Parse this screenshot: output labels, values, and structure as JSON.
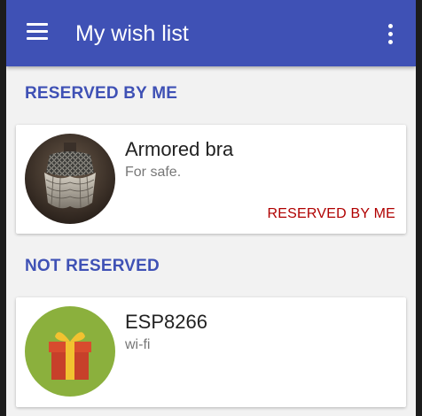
{
  "appbar": {
    "title": "My wish list",
    "menu_icon": "hamburger-menu-icon",
    "overflow_icon": "more-vert-icon",
    "color": "#3f51b5"
  },
  "sections": [
    {
      "header": "RESERVED BY ME",
      "items": [
        {
          "name": "Armored bra",
          "description": "For safe.",
          "status": "RESERVED BY ME",
          "image": "armor-photo"
        }
      ]
    },
    {
      "header": "NOT RESERVED",
      "items": [
        {
          "name": "ESP8266",
          "description": "wi-fi",
          "image": "gift-icon"
        }
      ]
    }
  ],
  "colors": {
    "accent": "#3f51b5",
    "reserved_text": "#b00000",
    "gift_background": "#8bb03d"
  }
}
